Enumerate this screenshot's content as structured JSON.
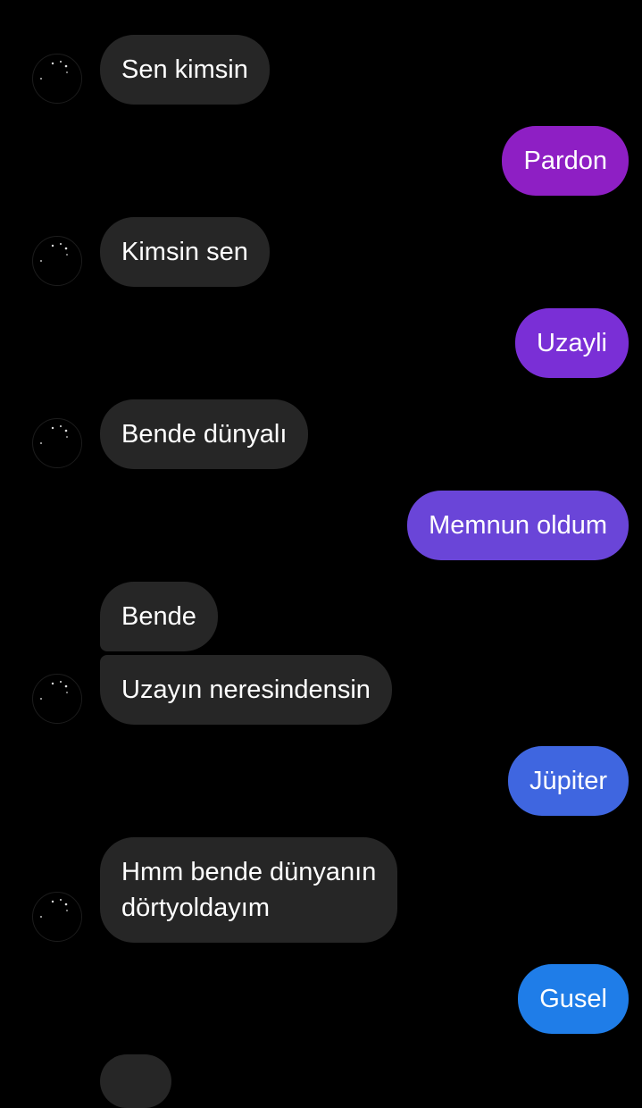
{
  "messages": [
    {
      "side": "in",
      "text": "Sen kimsin"
    },
    {
      "side": "out",
      "text": "Pardon"
    },
    {
      "side": "in",
      "text": "Kimsin sen"
    },
    {
      "side": "out",
      "text": "Uzayli"
    },
    {
      "side": "in",
      "text": "Bende dünyalı"
    },
    {
      "side": "out",
      "text": "Memnun oldum"
    },
    {
      "side": "in",
      "text": "Bende"
    },
    {
      "side": "in",
      "text": "Uzayın neresindensin"
    },
    {
      "side": "out",
      "text": "Jüpiter"
    },
    {
      "side": "in",
      "text": "Hmm bende dünyanın"
    },
    {
      "side": "in",
      "text": "dörtyoldayım"
    },
    {
      "side": "out",
      "text": "Gusel"
    }
  ],
  "avatar_icon": "contact-avatar-icon",
  "colors": {
    "background": "#000000",
    "incoming_bubble": "#262626",
    "outgoing_gradient": [
      "#8e1fc4",
      "#7a2fd6",
      "#6a45d8",
      "#3f66e0",
      "#1f7de8"
    ]
  }
}
